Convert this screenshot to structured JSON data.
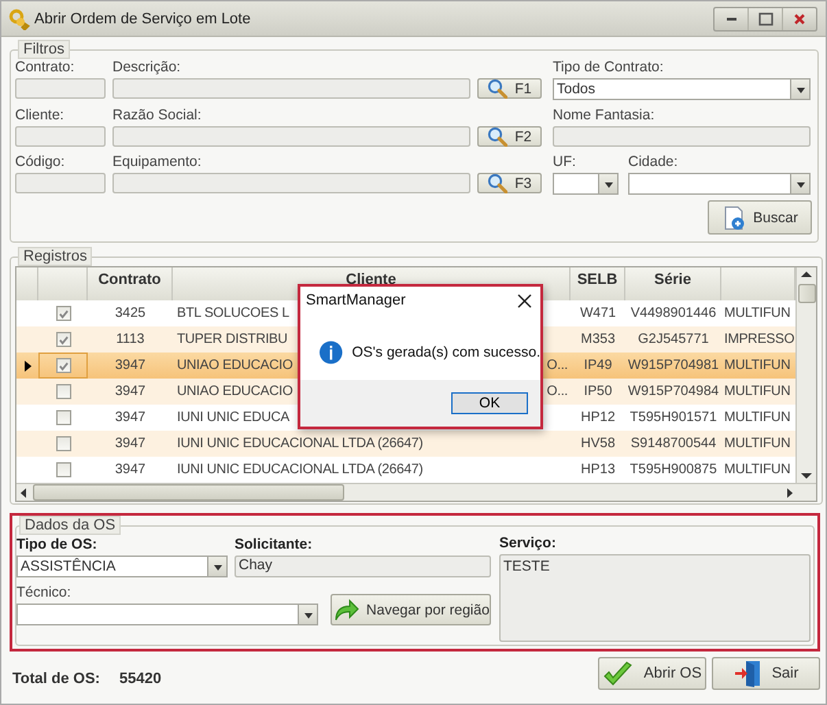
{
  "window": {
    "title": "Abrir Ordem de Serviço em Lote"
  },
  "filters": {
    "title": "Filtros",
    "rows": [
      {
        "code_label": "Contrato:",
        "desc_label": "Descrição:",
        "button": "F1",
        "right": [
          {
            "kind": "combo",
            "label": "Tipo de Contrato:",
            "value": "Todos"
          }
        ]
      },
      {
        "code_label": "Cliente:",
        "desc_label": "Razão Social:",
        "button": "F2",
        "right": [
          {
            "kind": "text",
            "label": "Nome Fantasia:"
          }
        ]
      },
      {
        "code_label": "Código:",
        "desc_label": "Equipamento:",
        "button": "F3",
        "right": [
          {
            "kind": "combo",
            "label": "UF:"
          },
          {
            "kind": "combo",
            "label": "Cidade:"
          }
        ]
      }
    ],
    "search_button": "Buscar"
  },
  "records": {
    "title": "Registros",
    "columns": [
      "Contrato",
      "Cliente",
      "SELB",
      "Série"
    ],
    "rows": [
      {
        "checked": true,
        "selected": false,
        "contrato": "3425",
        "cliente": "BTL SOLUCOES L",
        "selb": "W471",
        "serie": "V4498901446",
        "column_7": "MULTIFUN"
      },
      {
        "checked": true,
        "selected": false,
        "contrato": "1113",
        "cliente": "TUPER DISTRIBU",
        "selb": "M353",
        "serie": "G2J545771",
        "column_7": "IMPRESSO"
      },
      {
        "checked": true,
        "selected": true,
        "contrato": "3947",
        "cliente": "UNIAO EDUCACIO",
        "cliente_tail": "O...",
        "selb": "IP49",
        "serie": "W915P704981",
        "column_7": "MULTIFUN"
      },
      {
        "checked": false,
        "selected": false,
        "contrato": "3947",
        "cliente": "UNIAO EDUCACIO",
        "cliente_tail": "O...",
        "selb": "IP50",
        "serie": "W915P704984",
        "column_7": "MULTIFUN"
      },
      {
        "checked": false,
        "selected": false,
        "contrato": "3947",
        "cliente": "IUNI UNIC EDUCA",
        "selb": "HP12",
        "serie": "T595H901571",
        "column_7": "MULTIFUN"
      },
      {
        "checked": false,
        "selected": false,
        "contrato": "3947",
        "cliente": "IUNI UNIC EDUCACIONAL LTDA (26647)",
        "selb": "HV58",
        "serie": "S9148700544",
        "column_7": "MULTIFUN"
      },
      {
        "checked": false,
        "selected": false,
        "contrato": "3947",
        "cliente": "IUNI UNIC EDUCACIONAL LTDA (26647)",
        "selb": "HP13",
        "serie": "T595H900875",
        "column_7": "MULTIFUN"
      }
    ]
  },
  "dialog": {
    "title": "SmartManager",
    "message": "OS's gerada(s) com sucesso.",
    "button": "OK"
  },
  "os_data": {
    "title": "Dados da OS",
    "tipo_label": "Tipo de OS:",
    "tipo_value": "ASSISTÊNCIA",
    "solicitante_label": "Solicitante:",
    "solicitante_value": "Chay",
    "servico_label": "Serviço:",
    "servico_value": "TESTE",
    "tecnico_label": "Técnico:",
    "navigate_button": "Navegar por região"
  },
  "footer": {
    "total_label": "Total de OS:",
    "total_value": "55420",
    "buttons": [
      {
        "kind": "open",
        "label": "Abrir OS"
      },
      {
        "kind": "exit",
        "label": "Sair"
      }
    ]
  }
}
